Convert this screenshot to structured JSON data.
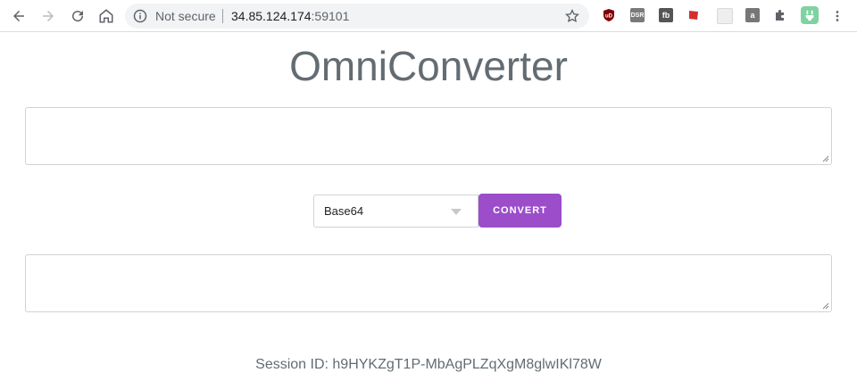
{
  "browser": {
    "security_label": "Not secure",
    "url_host": "34.85.124.174",
    "url_port": ":59101",
    "extensions": [
      {
        "name": "ublock-origin-icon",
        "text": "uD",
        "color": "#800000"
      },
      {
        "name": "dsr-extension-icon",
        "text": "DSR",
        "color": "#7a7a7a"
      },
      {
        "name": "fb-extension-icon",
        "text": "fb",
        "color": "#555555"
      },
      {
        "name": "red-extension-icon",
        "text": "",
        "color": "#d32f2f"
      },
      {
        "name": "gray-extension-icon",
        "text": "",
        "color": "#d9d9d9"
      },
      {
        "name": "a-extension-icon",
        "text": "a",
        "color": "#777777"
      },
      {
        "name": "puzzle-extensions-icon",
        "text": "",
        "color": "#5f6368"
      },
      {
        "name": "green-extension-icon",
        "text": "",
        "color": "#2ecc71"
      }
    ]
  },
  "page": {
    "title": "OmniConverter",
    "input_value": "",
    "output_value": "",
    "selected_format": "Base64",
    "convert_label": "CONVERT",
    "session_label": "Session ID: h9HYKZgT1P-MbAgPLZqXgM8glwIKl78W"
  },
  "colors": {
    "accent": "#9b4dca",
    "title": "#636c72"
  }
}
